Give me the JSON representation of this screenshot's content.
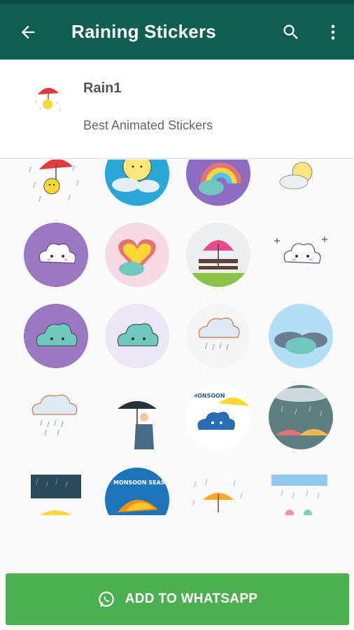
{
  "app": {
    "title": "Raining Stickers",
    "colors": {
      "toolbar": "#0f5e52",
      "statusbar": "#0b4a41",
      "button": "#4caf50"
    },
    "icons": [
      "back-arrow-icon",
      "search-icon",
      "more-vert-icon"
    ]
  },
  "pack": {
    "name": "Rain1",
    "publisher": "Best Animated Stickers"
  },
  "stickers": [
    {
      "name": "umbrella-sun-rain"
    },
    {
      "name": "sun-cloud-rain-circle"
    },
    {
      "name": "rainbow-cloud-circle"
    },
    {
      "name": "sun-cloud-sketch"
    },
    {
      "name": "cute-cloud-purple"
    },
    {
      "name": "rainbow-heart-cloud"
    },
    {
      "name": "pink-umbrella-bench"
    },
    {
      "name": "cute-cloud-sparkles"
    },
    {
      "name": "teal-cloud-purple"
    },
    {
      "name": "teal-cloud-dotted"
    },
    {
      "name": "rain-cloud-pale"
    },
    {
      "name": "two-clouds"
    },
    {
      "name": "rain-cloud-outline"
    },
    {
      "name": "man-umbrella"
    },
    {
      "name": "monsoon-yellow-umbrella"
    },
    {
      "name": "rain-umbrella-grey"
    },
    {
      "name": "dark-rain-umbrella"
    },
    {
      "name": "monsoon-season"
    },
    {
      "name": "umbrella-rain-white"
    },
    {
      "name": "clouds-blue-rain"
    }
  ],
  "monsoon_text": "MONSOON",
  "monsoon_season_text": "MONSOON SEASON",
  "add_button": {
    "label": "ADD TO WHATSAPP",
    "icon": "whatsapp-icon"
  }
}
